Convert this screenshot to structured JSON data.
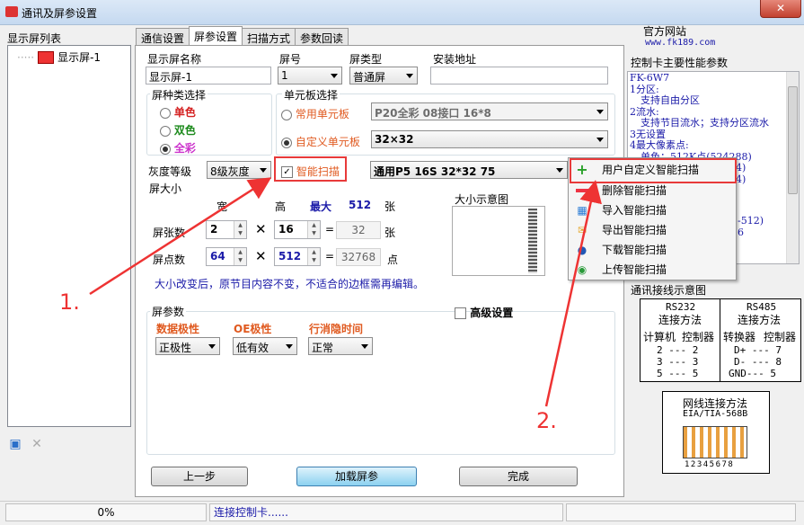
{
  "window": {
    "title": "通讯及屏参设置",
    "close": "✕"
  },
  "left": {
    "list_label": "显示屏列表",
    "item": "显示屏-1"
  },
  "tabs": [
    "通信设置",
    "屏参设置",
    "扫描方式",
    "参数回读"
  ],
  "form": {
    "name_label": "显示屏名称",
    "name_value": "显示屏-1",
    "num_label": "屏号",
    "num_value": "1",
    "type_label": "屏类型",
    "type_value": "普通屏",
    "addr_label": "安装地址",
    "addr_value": "",
    "kind_group": "屏种类选择",
    "kind_options": [
      "单色",
      "双色",
      "全彩"
    ],
    "unit_group": "单元板选择",
    "unit_common": "常用单元板",
    "unit_common_value": "P20全彩 08接口 16*8",
    "unit_custom": "自定义单元板",
    "unit_custom_value": "32×32",
    "gray_label": "灰度等级",
    "gray_value": "8级灰度",
    "smart_label": "智能扫描",
    "scan_value": "通用P5 16S 32*32 75",
    "size_group": "屏大小",
    "width_label": "宽",
    "height_label": "高",
    "max_label": "最大",
    "max_value": "512",
    "zhang": "张",
    "count_label": "屏张数",
    "count_w": "2",
    "count_h": "16",
    "count_total": "32",
    "count_unit": "张",
    "dot_label": "屏点数",
    "dot_w": "64",
    "dot_h": "512",
    "dot_total": "32768",
    "dot_unit": "点",
    "preview_label": "大小示意图",
    "note": "大小改变后，原节目内容不变，不适合的边框需再编辑。",
    "param_group": "屏参数",
    "adv_label": "高级设置",
    "data_pol_label": "数据极性",
    "data_pol_value": "正极性",
    "oe_label": "OE极性",
    "oe_value": "低有效",
    "blank_label": "行消隐时间",
    "blank_value": "正常"
  },
  "buttons": {
    "prev": "上一步",
    "load": "加载屏参",
    "done": "完成"
  },
  "status": {
    "progress": "0%",
    "msg": "连接控制卡......"
  },
  "right": {
    "site_label": "官方网站",
    "site_url": "www.fk189.com",
    "spec_title": "控制卡主要性能参数",
    "spec_lines": [
      "FK-6W7",
      "1分区:",
      "支持自由分区",
      "2流水:",
      "支持节目流水；支持分区流水",
      "3无设置",
      "4最大像素点:",
      "单色：512K点(524288)",
      "4)",
      "4)",
      "-512)",
      "6"
    ],
    "conn_title": "通讯接线示意图",
    "rs232": "RS232",
    "rs232_method": "连接方法",
    "rs485": "RS485",
    "rs485_method": "连接方法",
    "pc": "计算机",
    "ctrl": "控制器",
    "conv": "转换器",
    "ctrl2": "控制器",
    "rows232": [
      "2 --- 2",
      "3 --- 3",
      "5 --- 5"
    ],
    "rows485": [
      "D+ --- 7",
      "D- --- 8",
      "GND--- 5"
    ],
    "eth_title": "网线连接方法",
    "eth_std": "EIA/TIA-568B",
    "eth_pins": "12345678"
  },
  "menu": [
    "用户自定义智能扫描",
    "删除智能扫描",
    "导入智能扫描",
    "导出智能扫描",
    "下载智能扫描",
    "上传智能扫描"
  ],
  "annotations": [
    "1.",
    "2."
  ]
}
